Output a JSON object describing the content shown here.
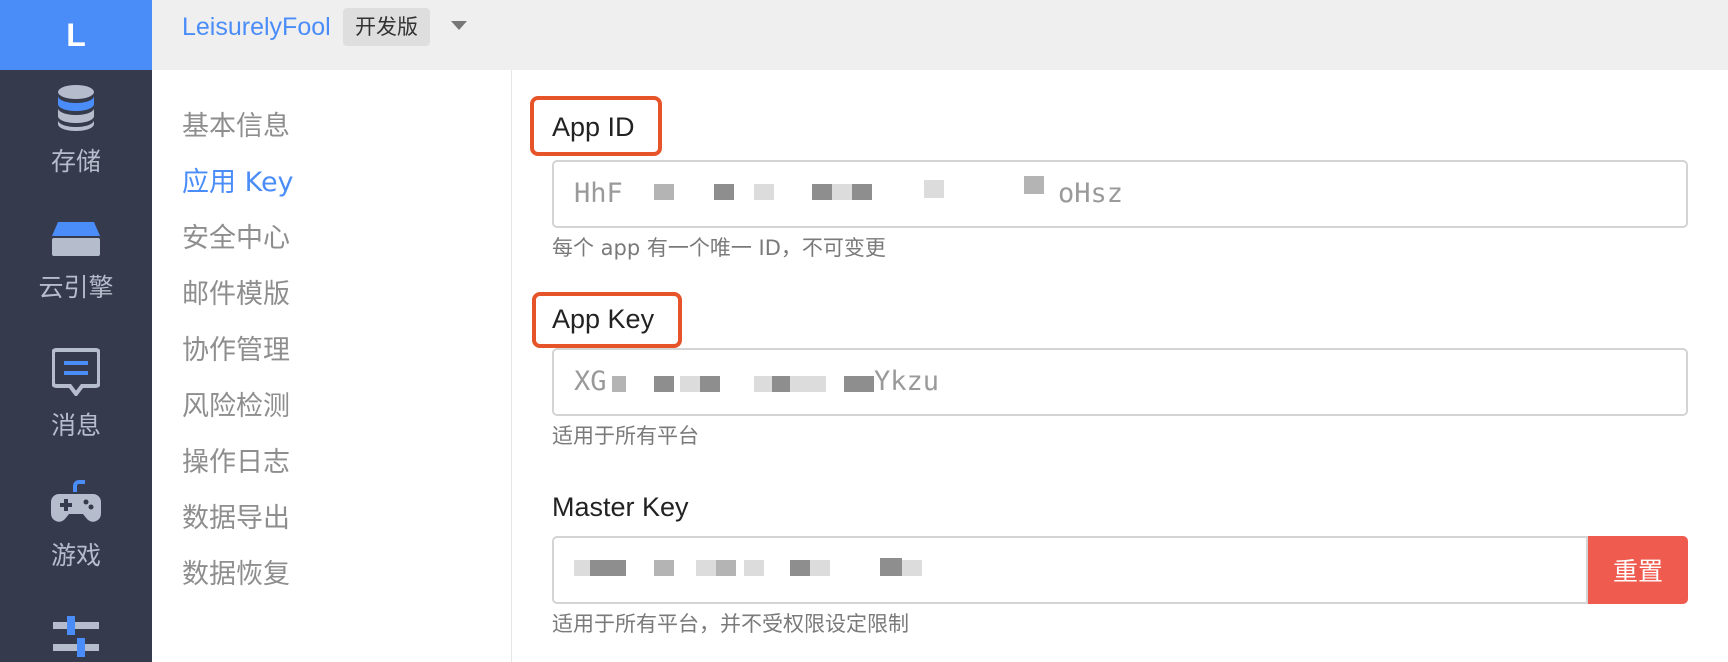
{
  "rail": {
    "logo": "L",
    "items": [
      {
        "label": "存储",
        "icon": "database-icon"
      },
      {
        "label": "云引擎",
        "icon": "server-icon"
      },
      {
        "label": "消息",
        "icon": "message-icon"
      },
      {
        "label": "游戏",
        "icon": "gamepad-icon"
      },
      {
        "label": "",
        "icon": "sliders-icon"
      }
    ]
  },
  "topbar": {
    "app_name": "LeisurelyFool",
    "badge": "开发版",
    "caret_icon": "caret-down-icon"
  },
  "subnav": {
    "items": [
      "基本信息",
      "应用 Key",
      "安全中心",
      "邮件模版",
      "协作管理",
      "风险检测",
      "操作日志",
      "数据导出",
      "数据恢复"
    ],
    "active_index": 1
  },
  "fields": {
    "app_id": {
      "label": "App ID",
      "value_start": "HhF",
      "value_end": "oHsz",
      "help": "每个 app 有一个唯一 ID，不可变更"
    },
    "app_key": {
      "label": "App Key",
      "value_start": "XG",
      "value_end": "Ykzu",
      "help": "适用于所有平台"
    },
    "master_key": {
      "label": "Master Key",
      "reset_label": "重置",
      "help": "适用于所有平台，并不受权限设定限制"
    }
  },
  "colors": {
    "accent": "#4b8df8",
    "rail_bg": "#353b4d",
    "highlight": "#e8542a",
    "danger": "#ef5b4f"
  }
}
